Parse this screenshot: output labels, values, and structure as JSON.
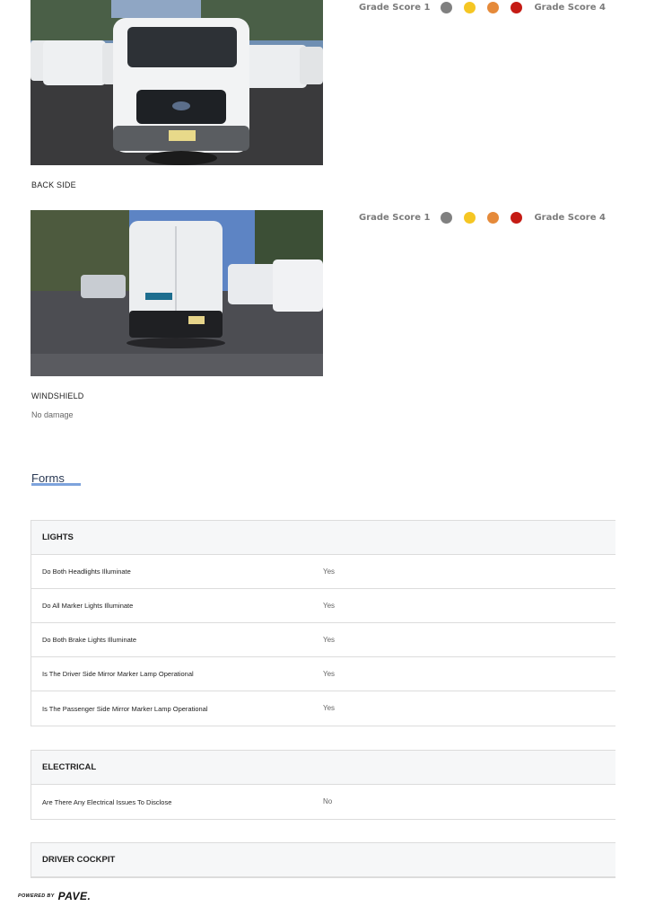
{
  "grade_rows": [
    {
      "low_label": "Grade Score 1",
      "high_label": "Grade Score 4",
      "dots": [
        "#808080",
        "#f5c623",
        "#e58a3a",
        "#c51b14"
      ]
    },
    {
      "low_label": "Grade Score 1",
      "high_label": "Grade Score 4",
      "dots": [
        "#808080",
        "#f5c623",
        "#e58a3a",
        "#c51b14"
      ]
    }
  ],
  "sections": {
    "back_side": "BACK SIDE",
    "windshield": "WINDSHIELD",
    "windshield_note": "No damage"
  },
  "forms": {
    "title": "Forms",
    "accent": "#7da3dc",
    "tables": [
      {
        "header": "LIGHTS",
        "rows": [
          {
            "question": "Do Both Headlights Illuminate",
            "answer": "Yes"
          },
          {
            "question": "Do All Marker Lights Illuminate",
            "answer": "Yes"
          },
          {
            "question": "Do Both Brake Lights Illuminate",
            "answer": "Yes"
          },
          {
            "question": "Is The Driver Side Mirror Marker Lamp Operational",
            "answer": "Yes"
          },
          {
            "question": "Is The Passenger Side Mirror Marker Lamp Operational",
            "answer": "Yes"
          }
        ]
      },
      {
        "header": "ELECTRICAL",
        "rows": [
          {
            "question": "Are There Any Electrical Issues To Disclose",
            "answer": "No"
          }
        ]
      },
      {
        "header": "DRIVER COCKPIT",
        "rows": []
      }
    ]
  },
  "footer": {
    "powered_by": "POWERED BY",
    "brand": "PAVE."
  }
}
